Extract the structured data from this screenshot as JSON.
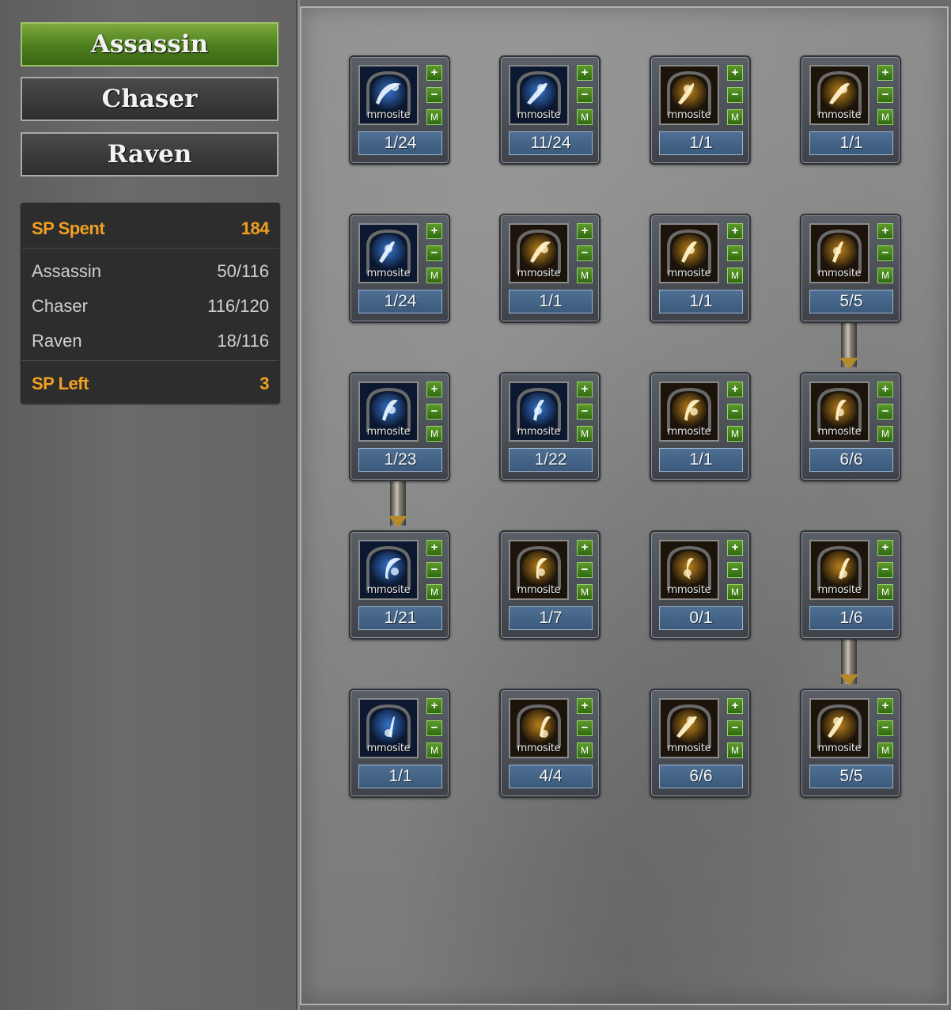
{
  "tabs": [
    {
      "label": "Assassin",
      "active": true
    },
    {
      "label": "Chaser",
      "active": false
    },
    {
      "label": "Raven",
      "active": false
    }
  ],
  "sp": {
    "spent_label": "SP Spent",
    "spent_value": "184",
    "rows": [
      {
        "name": "Assassin",
        "value": "50/116"
      },
      {
        "name": "Chaser",
        "value": "116/120"
      },
      {
        "name": "Raven",
        "value": "18/116"
      }
    ],
    "left_label": "SP Left",
    "left_value": "3"
  },
  "skill_controls": {
    "plus": "+",
    "minus": "−",
    "max": "M",
    "watermark": "mmosite"
  },
  "skills": [
    {
      "level": "1/24",
      "icon": "blade-slash-icon",
      "theme": "blue"
    },
    {
      "level": "11/24",
      "icon": "shadow-burst-icon",
      "theme": "blue"
    },
    {
      "level": "1/1",
      "icon": "bird-icon",
      "theme": "gold"
    },
    {
      "level": "1/1",
      "icon": "mushroom-cloud-icon",
      "theme": "gold"
    },
    {
      "level": "1/24",
      "icon": "dash-strike-icon",
      "theme": "blue"
    },
    {
      "level": "1/1",
      "icon": "spiral-icon",
      "theme": "gold"
    },
    {
      "level": "1/1",
      "icon": "boot-icon",
      "theme": "gold"
    },
    {
      "level": "5/5",
      "icon": "blade-figure-icon",
      "theme": "gold"
    },
    {
      "level": "1/23",
      "icon": "scatter-star-icon",
      "theme": "blue"
    },
    {
      "level": "1/22",
      "icon": "fist-icon",
      "theme": "blue"
    },
    {
      "level": "1/1",
      "icon": "radiant-figure-icon",
      "theme": "gold"
    },
    {
      "level": "6/6",
      "icon": "skull-fist-icon",
      "theme": "gold"
    },
    {
      "level": "1/21",
      "icon": "claw-slash-icon",
      "theme": "blue"
    },
    {
      "level": "1/7",
      "icon": "flame-shield-icon",
      "theme": "gold"
    },
    {
      "level": "0/1",
      "icon": "kick-icon",
      "theme": "gold"
    },
    {
      "level": "1/6",
      "icon": "hp-burst-icon",
      "theme": "gold"
    },
    {
      "level": "1/1",
      "icon": "whirlwind-icon",
      "theme": "blue"
    },
    {
      "level": "4/4",
      "icon": "rising-figure-icon",
      "theme": "gold"
    },
    {
      "level": "6/6",
      "icon": "mp-burst-icon",
      "theme": "gold"
    },
    {
      "level": "5/5",
      "icon": "mp-explosion-icon",
      "theme": "gold"
    }
  ],
  "colors": {
    "accent": "#f0a020",
    "active_tab": "#5a8a28",
    "level_bar": "#44658a",
    "button_green": "#4a8a1e"
  }
}
